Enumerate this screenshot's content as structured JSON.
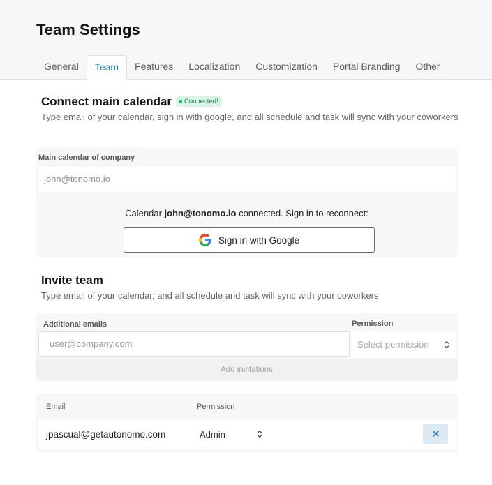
{
  "page": {
    "title": "Team Settings"
  },
  "tabs": [
    {
      "label": "General",
      "active": false
    },
    {
      "label": "Team",
      "active": true
    },
    {
      "label": "Features",
      "active": false
    },
    {
      "label": "Localization",
      "active": false
    },
    {
      "label": "Customization",
      "active": false
    },
    {
      "label": "Portal Branding",
      "active": false
    },
    {
      "label": "Other",
      "active": false
    }
  ],
  "connect": {
    "title": "Connect main calendar",
    "badge": "Connected!",
    "description": "Type email of your calendar, sign in with google, and all schedule and task will sync with your coworkers",
    "field_label": "Main calendar of company",
    "field_value": "john@tonomo.io",
    "note_prefix": "Calendar ",
    "note_email": "john@tonomo.io",
    "note_suffix": " connected. Sign in to reconnect:",
    "google_button": "Sign in with Google"
  },
  "invite": {
    "title": "Invite team",
    "description": "Type email of your calendar, and all schedule and task will sync with your coworkers",
    "emails_label": "Additional emails",
    "emails_placeholder": "user@company.com",
    "permission_label": "Permission",
    "permission_placeholder": "Select permission",
    "add_button": "Add invitations"
  },
  "members": {
    "headers": {
      "email": "Email",
      "permission": "Permission"
    },
    "rows": [
      {
        "email": "jpascual@getautonomo.com",
        "permission": "Admin",
        "remove_icon": "close-icon"
      }
    ]
  },
  "colors": {
    "accent": "#2b7fc2",
    "badge_bg": "#d9f4e6",
    "badge_dot": "#22b36b",
    "remove_bg": "#dde9f3"
  }
}
